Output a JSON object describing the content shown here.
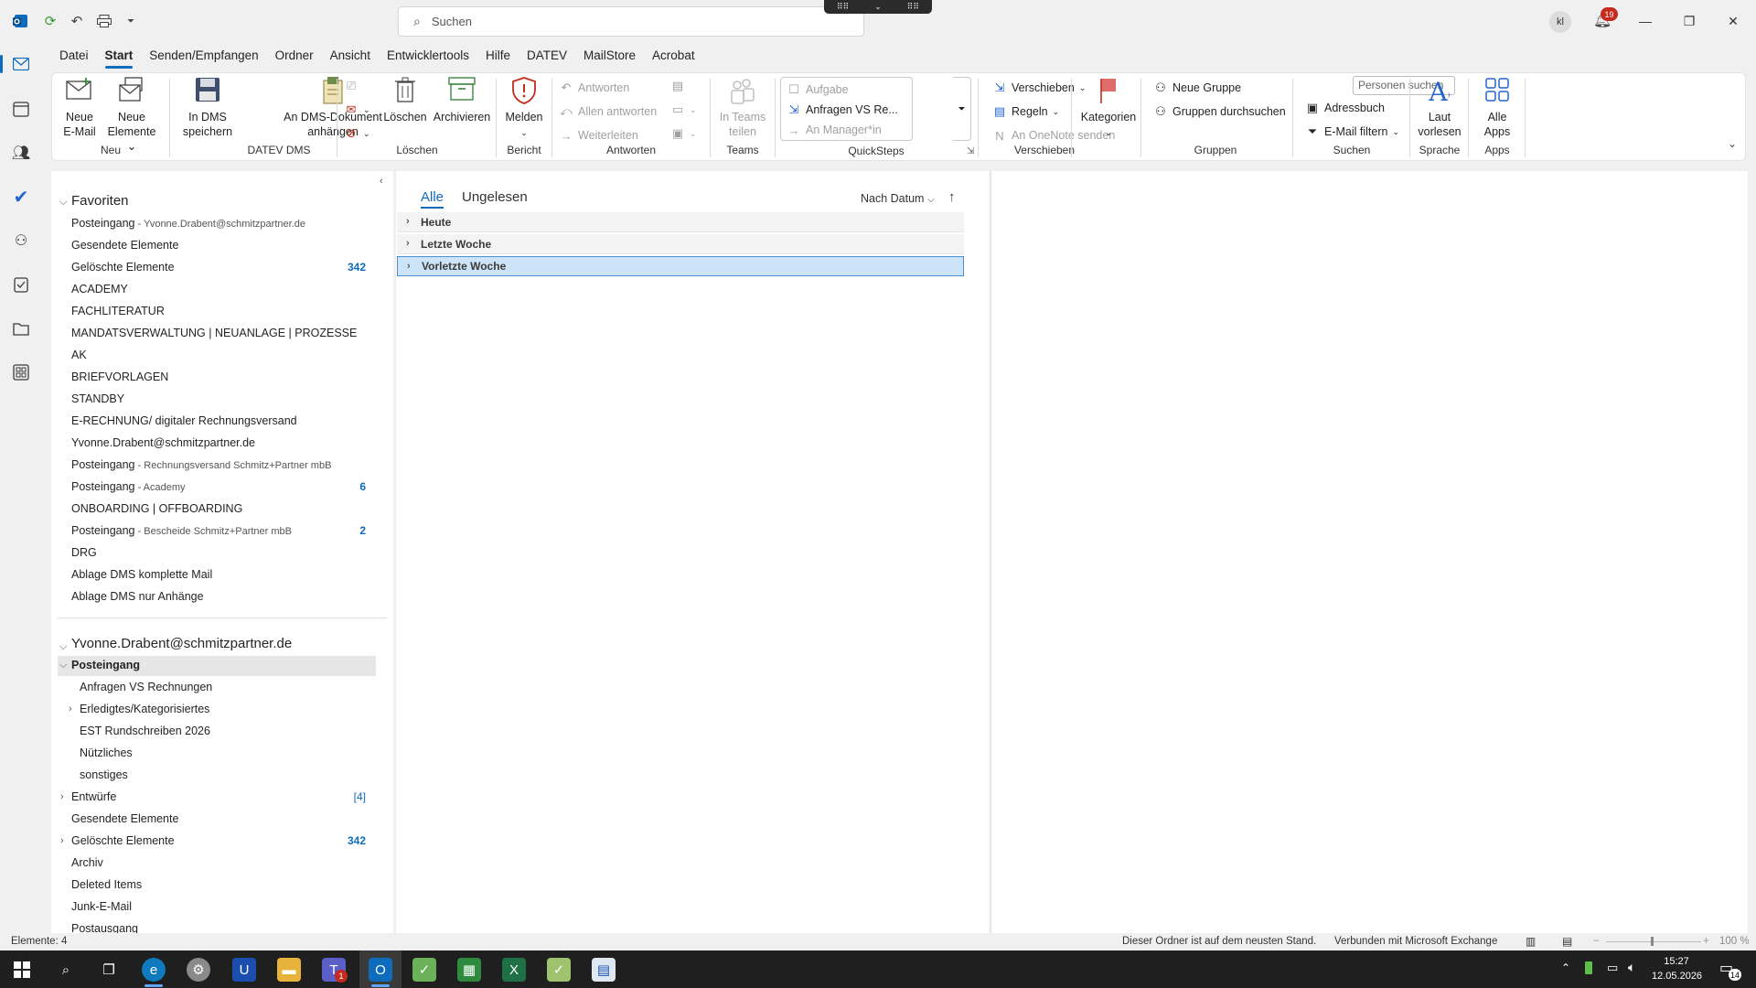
{
  "titlebar": {
    "search_placeholder": "Suchen",
    "avatar_initials": "kl",
    "notification_count": "19",
    "icons": [
      "outlook-logo-icon",
      "sync-icon",
      "undo-icon",
      "print-icon",
      "customize-qat-icon"
    ]
  },
  "menu": {
    "tabs": [
      "Datei",
      "Start",
      "Senden/Empfangen",
      "Ordner",
      "Ansicht",
      "Entwicklertools",
      "Hilfe",
      "DATEV",
      "MailStore",
      "Acrobat"
    ],
    "active": "Start"
  },
  "ribbon": {
    "neu": {
      "label": "Neu",
      "new_email": [
        "Neue",
        "E-Mail"
      ],
      "new_items": [
        "Neue",
        "Elemente"
      ]
    },
    "datev_dms": {
      "label": "DATEV DMS",
      "save_dms": [
        "In DMS",
        "speichern"
      ],
      "attach_dms": [
        "An DMS-Dokument",
        "anhängen"
      ]
    },
    "loeschen": {
      "label": "Löschen",
      "delete": "Löschen",
      "archive": "Archivieren"
    },
    "bericht": {
      "label": "Bericht",
      "report": "Melden"
    },
    "antworten": {
      "label": "Antworten",
      "reply": "Antworten",
      "reply_all": "Allen antworten",
      "forward": "Weiterleiten"
    },
    "teams": {
      "label": "Teams",
      "share": [
        "In Teams",
        "teilen"
      ]
    },
    "quicksteps": {
      "label": "QuickSteps",
      "items": [
        "Aufgabe",
        "Anfragen VS Re...",
        "An Manager*in"
      ]
    },
    "verschieben": {
      "label": "Verschieben",
      "move": "Verschieben",
      "rules": "Regeln",
      "onenote": "An OneNote senden"
    },
    "kategorien": {
      "label": "Kategorien"
    },
    "gruppen": {
      "label": "Gruppen",
      "new_group": "Neue Gruppe",
      "browse_groups": "Gruppen durchsuchen"
    },
    "suchen": {
      "label": "Suchen",
      "people_placeholder": "Personen suchen",
      "address_book": "Adressbuch",
      "filter_email": "E-Mail filtern"
    },
    "sprache": {
      "label": "Sprache",
      "read_aloud": [
        "Laut",
        "vorlesen"
      ]
    },
    "apps": {
      "label": "Apps",
      "all_apps": [
        "Alle",
        "Apps"
      ]
    }
  },
  "folders": {
    "favorites_header": "Favoriten",
    "favorites": [
      {
        "name": "Posteingang",
        "sub": " - Yvonne.Drabent@schmitzpartner.de",
        "count": ""
      },
      {
        "name": "Gesendete Elemente",
        "sub": "",
        "count": ""
      },
      {
        "name": "Gelöschte Elemente",
        "sub": "",
        "count": "342"
      },
      {
        "name": "ACADEMY",
        "sub": "",
        "count": ""
      },
      {
        "name": "FACHLITERATUR",
        "sub": "",
        "count": ""
      },
      {
        "name": "MANDATSVERWALTUNG | NEUANLAGE | PROZESSE",
        "sub": "",
        "count": ""
      },
      {
        "name": "AK",
        "sub": "",
        "count": ""
      },
      {
        "name": "BRIEFVORLAGEN",
        "sub": "",
        "count": ""
      },
      {
        "name": "STANDBY",
        "sub": "",
        "count": ""
      },
      {
        "name": "E-RECHNUNG/ digitaler Rechnungsversand",
        "sub": "",
        "count": ""
      },
      {
        "name": "Yvonne.Drabent@schmitzpartner.de",
        "sub": "",
        "count": ""
      },
      {
        "name": "Posteingang",
        "sub": " - Rechnungsversand Schmitz+Partner mbB",
        "count": ""
      },
      {
        "name": "Posteingang",
        "sub": " - Academy",
        "count": "6"
      },
      {
        "name": "ONBOARDING | OFFBOARDING",
        "sub": "",
        "count": ""
      },
      {
        "name": "Posteingang",
        "sub": " - Bescheide Schmitz+Partner mbB",
        "count": "2"
      },
      {
        "name": "DRG",
        "sub": "",
        "count": ""
      },
      {
        "name": "Ablage DMS komplette Mail",
        "sub": "",
        "count": ""
      },
      {
        "name": "Ablage DMS nur Anhänge",
        "sub": "",
        "count": ""
      }
    ],
    "account_header": "Yvonne.Drabent@schmitzpartner.de",
    "inbox": "Posteingang",
    "inbox_children": [
      "Anfragen VS Rechnungen",
      "Erledigtes/Kategorisiertes",
      "EST Rundschreiben 2026",
      "Nützliches",
      "sonstiges"
    ],
    "account_folders": [
      {
        "name": "Entwürfe",
        "count": "[4]"
      },
      {
        "name": "Gesendete Elemente",
        "count": ""
      },
      {
        "name": "Gelöschte Elemente",
        "count": "342"
      },
      {
        "name": "Archiv",
        "count": ""
      },
      {
        "name": "Deleted Items",
        "count": ""
      },
      {
        "name": "Junk-E-Mail",
        "count": ""
      },
      {
        "name": "Postausgang",
        "count": ""
      }
    ]
  },
  "list": {
    "tab_all": "Alle",
    "tab_unread": "Ungelesen",
    "sort": "Nach Datum",
    "groups": [
      "Heute",
      "Letzte Woche",
      "Vorletzte Woche"
    ],
    "selected_group": "Vorletzte Woche"
  },
  "status": {
    "items": "Elemente: 4",
    "folder_status": "Dieser Ordner ist auf dem neusten Stand.",
    "connection": "Verbunden mit Microsoft Exchange",
    "zoom": "100 %"
  },
  "taskbar": {
    "time": "15:27",
    "date": "12.05.2026",
    "notifications": "14"
  },
  "colors": {
    "accent": "#0f6cbd",
    "badge": "#c42b1c"
  }
}
